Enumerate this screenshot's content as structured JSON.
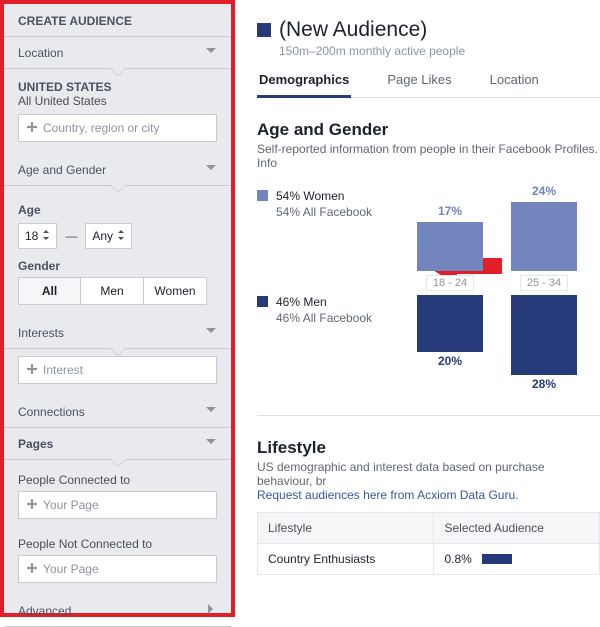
{
  "sidebar": {
    "title": "CREATE AUDIENCE",
    "location": {
      "label": "Location",
      "region_title": "UNITED STATES",
      "region_sub": "All United States",
      "placeholder": "Country, region or city"
    },
    "age_gender": {
      "label": "Age and Gender",
      "age_label": "Age",
      "age_from": "18",
      "age_to": "Any",
      "gender_label": "Gender",
      "gender_options": [
        "All",
        "Men",
        "Women"
      ],
      "gender_selected_index": 0
    },
    "interests": {
      "label": "Interests",
      "placeholder": "Interest"
    },
    "connections": {
      "label": "Connections"
    },
    "pages": {
      "label": "Pages",
      "connected_label": "People Connected to",
      "connected_placeholder": "Your Page",
      "not_connected_label": "People Not Connected to",
      "not_connected_placeholder": "Your Page"
    },
    "advanced": {
      "label": "Advanced"
    }
  },
  "main": {
    "title": "(New Audience)",
    "subtitle": "150m–200m monthly active people",
    "tabs": [
      "Demographics",
      "Page Likes",
      "Location"
    ],
    "tab_selected_index": 0,
    "demographics": {
      "heading": "Age and Gender",
      "subheading": "Self-reported information from people in their Facebook Profiles. Info",
      "legend_women": {
        "pct": "54% Women",
        "note": "54% All Facebook"
      },
      "legend_men": {
        "pct": "46% Men",
        "note": "46% All Facebook"
      }
    },
    "lifestyle": {
      "heading": "Lifestyle",
      "line1": "US demographic and interest data based on purchase behaviour, br",
      "line2": "Request audiences here from Acxiom Data Guru.",
      "columns": [
        "Lifestyle",
        "Selected Audience"
      ],
      "rows": [
        {
          "label": "Country Enthusiasts",
          "pct": "0.8%"
        }
      ]
    }
  },
  "chart_data": {
    "type": "bar",
    "categories": [
      "18 - 24",
      "25 - 34"
    ],
    "series": [
      {
        "name": "Women",
        "color": "#7385bd",
        "values": [
          17,
          24
        ]
      },
      {
        "name": "Men",
        "color": "#263a79",
        "values": [
          20,
          28
        ]
      }
    ],
    "unit": "%"
  }
}
